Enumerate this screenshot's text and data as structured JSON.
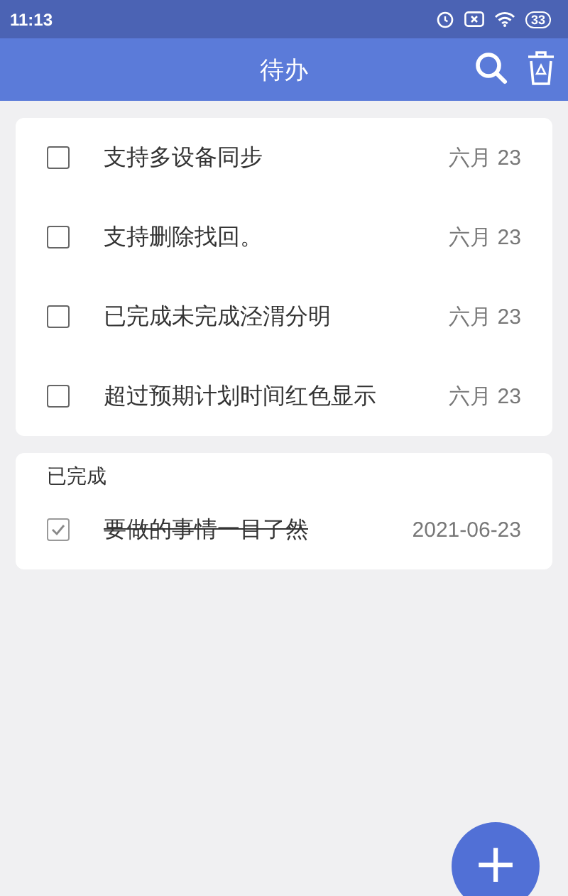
{
  "status_bar": {
    "time": "11:13",
    "battery": "33"
  },
  "header": {
    "title": "待办"
  },
  "todos": [
    {
      "text": "支持多设备同步",
      "date": "六月 23",
      "checked": false
    },
    {
      "text": "支持删除找回。",
      "date": "六月 23",
      "checked": false
    },
    {
      "text": "已完成未完成泾渭分明",
      "date": "六月 23",
      "checked": false
    },
    {
      "text": "超过预期计划时间红色显示",
      "date": "六月 23",
      "checked": false
    }
  ],
  "done": {
    "title": "已完成",
    "items": [
      {
        "text": "要做的事情一目了然",
        "date": "2021-06-23",
        "checked": true
      }
    ]
  },
  "fab": {
    "label": "+"
  }
}
